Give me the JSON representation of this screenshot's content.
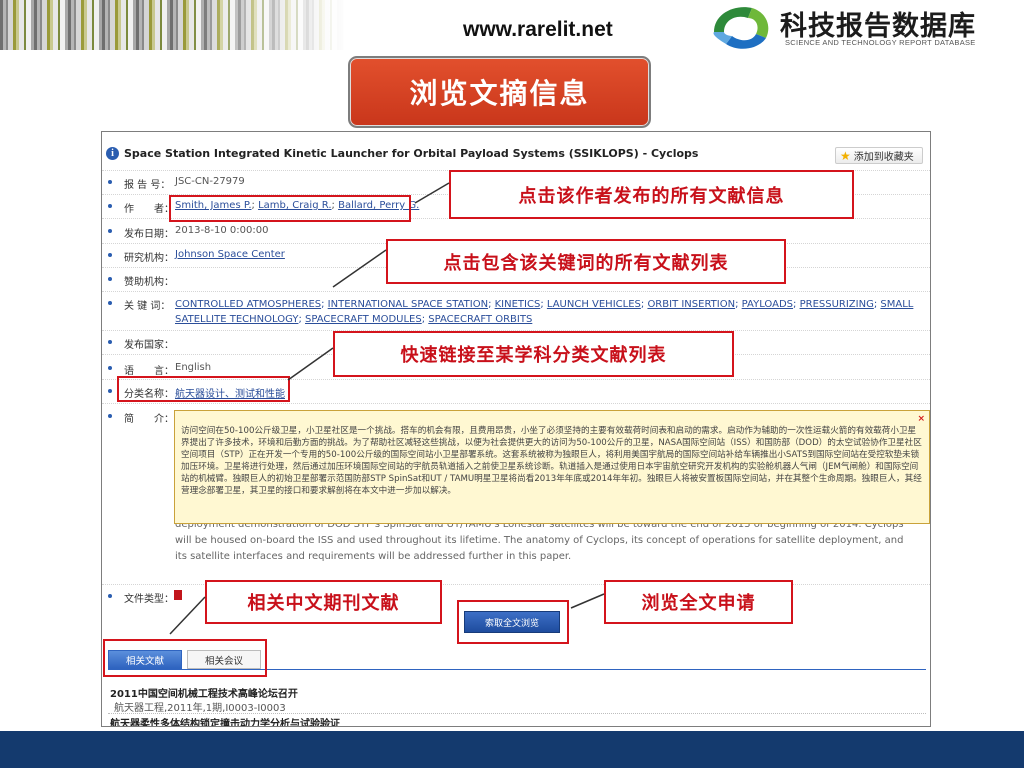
{
  "header": {
    "site_url": "www.rarelit.net",
    "logo_text": "科技报告数据库",
    "logo_subtitle": "SCIENCE AND TECHNOLOGY REPORT DATABASE"
  },
  "page_title": "浏览文摘信息",
  "record": {
    "title": "Space Station Integrated Kinetic Launcher for Orbital Payload Systems (SSIKLOPS) - Cyclops",
    "add_favorite": "添加到收藏夹",
    "fields": {
      "report_no_label": "报 告 号：",
      "report_no": "JSC-CN-27979",
      "author_label": "作　　者：",
      "authors": [
        "Smith, James P.",
        "Lamb, Craig R.",
        "Ballard, Perry G."
      ],
      "date_label": "发布日期：",
      "date": "2013-8-10 0:00:00",
      "org_label": "研究机构：",
      "org": "Johnson Space Center",
      "sponsor_label": "赞助机构：",
      "keywords_label": "关 键 词：",
      "keywords": [
        "CONTROLLED ATMOSPHERES",
        "INTERNATIONAL SPACE STATION",
        "KINETICS",
        "LAUNCH VEHICLES",
        "ORBIT INSERTION",
        "PAYLOADS",
        "PRESSURIZING",
        "SMALL SATELLITE TECHNOLOGY",
        "SPACECRAFT MODULES",
        "SPACECRAFT ORBITS"
      ],
      "country_label": "发布国家：",
      "language_label": "语　　言：",
      "language": "English",
      "category_label": "分类名称：",
      "category": "航天器设计、测试和性能",
      "abstract_label": "简　　介：",
      "filetype_label": "文件类型："
    },
    "abstract_translation": "访问空间在50-100公斤级卫星，小卫星社区是一个挑战。搭车的机会有限，且费用昂贵，小坐了必须坚持的主要有效载荷时间表和启动的需求。启动作为辅助的一次性运载火箭的有效载荷小卫星界提出了许多技术，环境和后勤方面的挑战。为了帮助社区减轻这些挑战，以便为社会提供更大的访问为50-100公斤的卫星，NASA国际空间站（ISS）和国防部（DOD）的太空试验协作卫星社区空间项目（STP）正在开发一个专用的50-100公斤级的国际空间站小卫星部署系统。这套系统被称为独眼巨人，将利用美国宇航局的国际空间站补给车辆推出小SATS到国际空间站在受控软垫未锁加压环境。卫星将进行处理，然后通过加压环境国际空间站的宇航员轨道插入之前使卫星系统诊断。轨道插入是通过使用日本宇宙航空研究开发机构的实验舱机器人气闸（JEM气闸舱）和国际空间站的机械臂。独眼巨人的初始卫星部署示范国防部STP SpinSat和UT / TAMU明星卫星将尚看2013年年底或2014年年初。独眼巨人将被安置板国际空间站，并在其整个生命周期。独眼巨人，其经营理念部署卫星，其卫星的接口和要求解剖将在本文中进一步加以解决。",
    "abstract_en": "deployment demonstration of DOD STP's SpinSat and UT/TAMU's Lonestar satellites will be toward the end of 2013 or beginning of 2014. Cyclops will be housed on-board the ISS and used throughout its lifetime. The anatomy of Cyclops, its concept of operations for satellite deployment, and its satellite interfaces and requirements will be addressed further in this paper.",
    "request_button": "索取全文浏览",
    "tip_close": "×"
  },
  "tabs": [
    {
      "label": "相关文献"
    },
    {
      "label": "相关会议"
    }
  ],
  "related": [
    {
      "title": "2011中国空间机械工程技术高峰论坛召开",
      "meta": "航天器工程,2011年,1期,I0003-I0003"
    },
    {
      "title": "航天器柔性多体结构锁定撞击动力学分析与试验验证",
      "meta": ""
    }
  ],
  "callouts": {
    "author": "点击该作者发布的所有文献信息",
    "keyword": "点击包含该关键词的所有文献列表",
    "category": "快速链接至某学科分类文献列表",
    "related": "相关中文期刊文献",
    "fulltext": "浏览全文申请"
  },
  "colors": {
    "accent_red": "#d4141c",
    "title_bg": "#d9431f",
    "link_blue": "#2b4e9a",
    "footer_navy": "#143a6e"
  }
}
